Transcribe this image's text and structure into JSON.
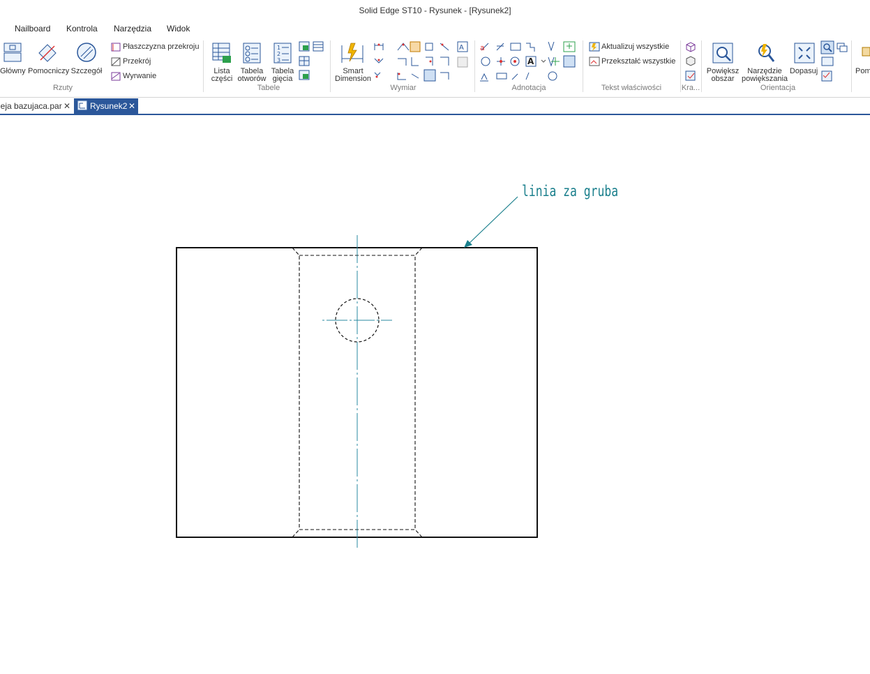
{
  "window": {
    "title": "Solid Edge ST10 - Rysunek - [Rysunek2]"
  },
  "menu": {
    "items": [
      "Nailboard",
      "Kontrola",
      "Narzędzia",
      "Widok"
    ]
  },
  "ribbon": {
    "rzuty": {
      "label": "Rzuty",
      "glowny": "Główny",
      "pomocniczy": "Pomocniczy",
      "szczegol": "Szczegół",
      "plaszczyzna": "Płaszczyzna przekroju",
      "przekroj": "Przekrój",
      "wyrwanie": "Wyrwanie"
    },
    "tabele": {
      "label": "Tabele",
      "lista_1": "Lista",
      "lista_2": "części",
      "otworow_1": "Tabela",
      "otworow_2": "otworów",
      "giecia_1": "Tabela",
      "giecia_2": "gięcia"
    },
    "wymiar": {
      "label": "Wymiar",
      "smart_1": "Smart",
      "smart_2": "Dimension"
    },
    "adnotacja": {
      "label": "Adnotacja"
    },
    "tekst": {
      "label": "Tekst właściwości",
      "aktualizuj": "Aktualizuj wszystkie",
      "przeksztalc": "Przekształć wszystkie"
    },
    "kra": {
      "label": "Kra..."
    },
    "orientacja": {
      "label": "Orientacja",
      "powieksz_1": "Powiększ",
      "powieksz_2": "obszar",
      "narzedzie_1": "Narzędzie",
      "narzedzie_2": "powiększania",
      "dopasuj": "Dopasuj"
    },
    "extra": {
      "label": "Pom"
    }
  },
  "doc_tabs": [
    {
      "label": "leja bazujaca.par",
      "active": false
    },
    {
      "label": "Rysunek2",
      "active": true
    }
  ],
  "drawing": {
    "annotation": "linia za gruba"
  },
  "colors": {
    "accent": "#2b579a",
    "annotation": "#1a7f8c",
    "centerline": "#2a8aa0"
  }
}
